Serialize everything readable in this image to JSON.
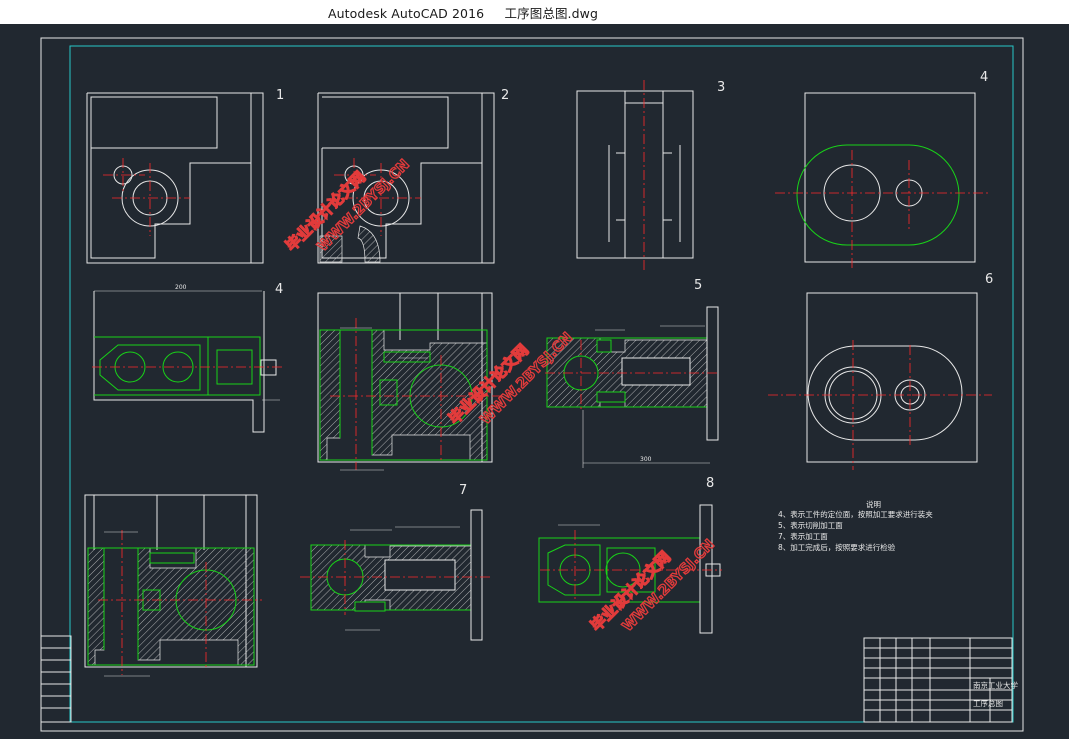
{
  "window": {
    "title": "Autodesk AutoCAD 2016     工序图总图.dwg"
  },
  "views": [
    {
      "label": "1"
    },
    {
      "label": "2"
    },
    {
      "label": "3"
    },
    {
      "label": "4"
    },
    {
      "label": "4"
    },
    {
      "label": "5"
    },
    {
      "label": "6"
    },
    {
      "label": "7"
    },
    {
      "label": "8"
    }
  ],
  "notes": {
    "heading": "说明",
    "lines": [
      "4、表示工件的定位面，按照加工要求进行装夹",
      "5、表示切削加工面",
      "7、表示加工面",
      "8、加工完成后，按照要求进行检验"
    ]
  },
  "title_block": {
    "university": "南京工业大学",
    "drawing_name": "工序总图"
  },
  "watermarks": [
    {
      "cn": "毕业设计论文网",
      "en": "WWW.2BYSJ.CN"
    },
    {
      "cn": "毕业设计论文网",
      "en": "WWW.2BYSJ.CN"
    },
    {
      "cn": "毕业设计论文网",
      "en": "WWW.2BYSJ.CN"
    }
  ],
  "colors": {
    "background": "#212830",
    "geometry": "#e8e8e8",
    "section": "#19d219",
    "centerline": "#ff2a2a",
    "frame": "#27c7c7",
    "watermark": "#e23b3b"
  }
}
